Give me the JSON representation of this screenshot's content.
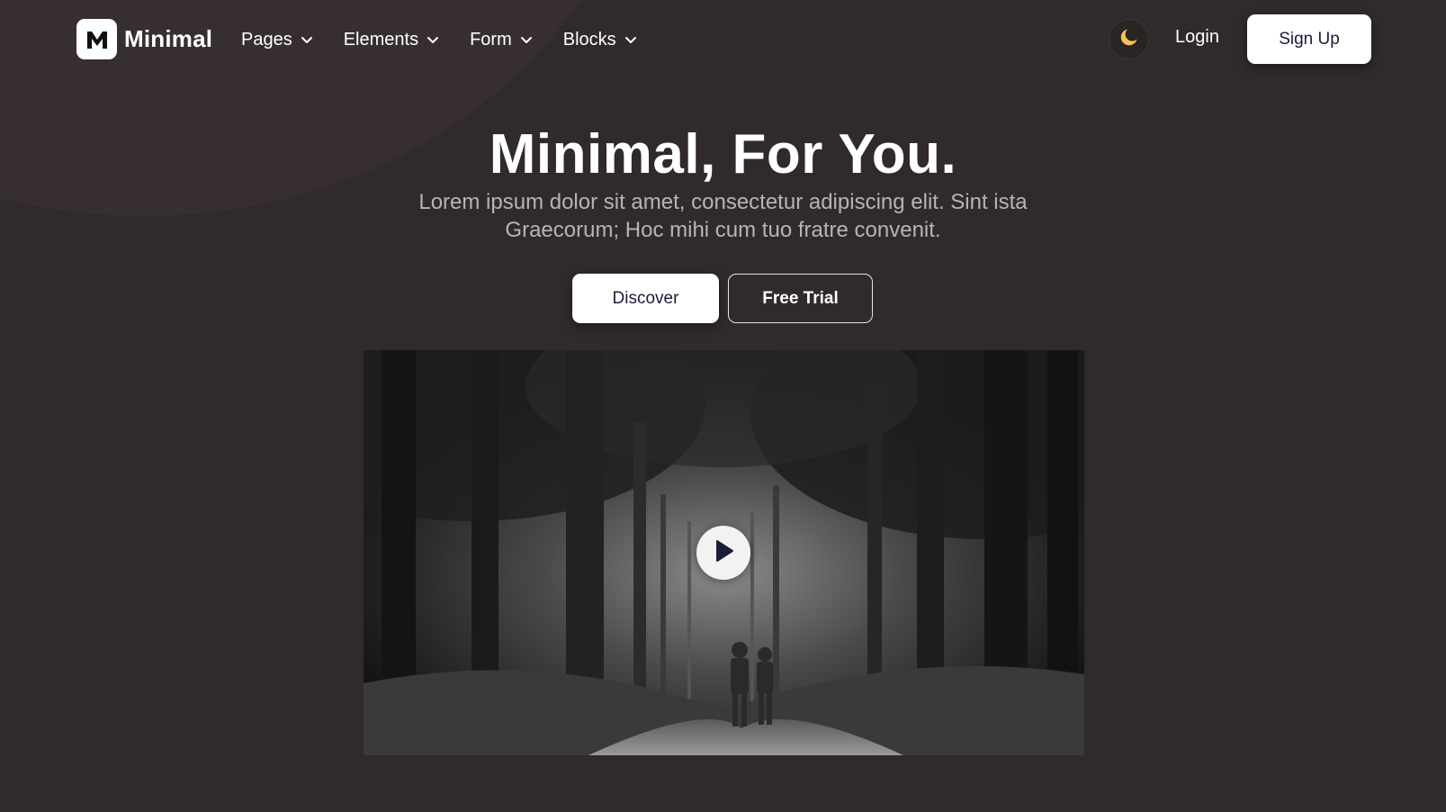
{
  "brand": {
    "name": "Minimal",
    "logo_letter": "M",
    "logo_icon": "m-logo-icon"
  },
  "nav": {
    "items": [
      {
        "label": "Pages",
        "icon": "chevron-down-icon"
      },
      {
        "label": "Elements",
        "icon": "chevron-down-icon"
      },
      {
        "label": "Form",
        "icon": "chevron-down-icon"
      },
      {
        "label": "Blocks",
        "icon": "chevron-down-icon"
      }
    ],
    "theme_icon": "moon-icon",
    "login_label": "Login",
    "signup_label": "Sign Up"
  },
  "hero": {
    "title": "Minimal, For You.",
    "subtitle": "Lorem ipsum dolor sit amet, consectetur adipiscing elit. Sint ista Graecorum; Hoc mihi cum tuo fratre convenit.",
    "discover_label": "Discover",
    "trial_label": "Free Trial"
  },
  "video": {
    "play_icon": "play-icon"
  },
  "colors": {
    "background": "#302a2a",
    "background_shape": "#372f2f",
    "accent_moon": "#f6c453",
    "button_text": "#1a1d3a",
    "subtitle_text": "#b9b3b3"
  }
}
